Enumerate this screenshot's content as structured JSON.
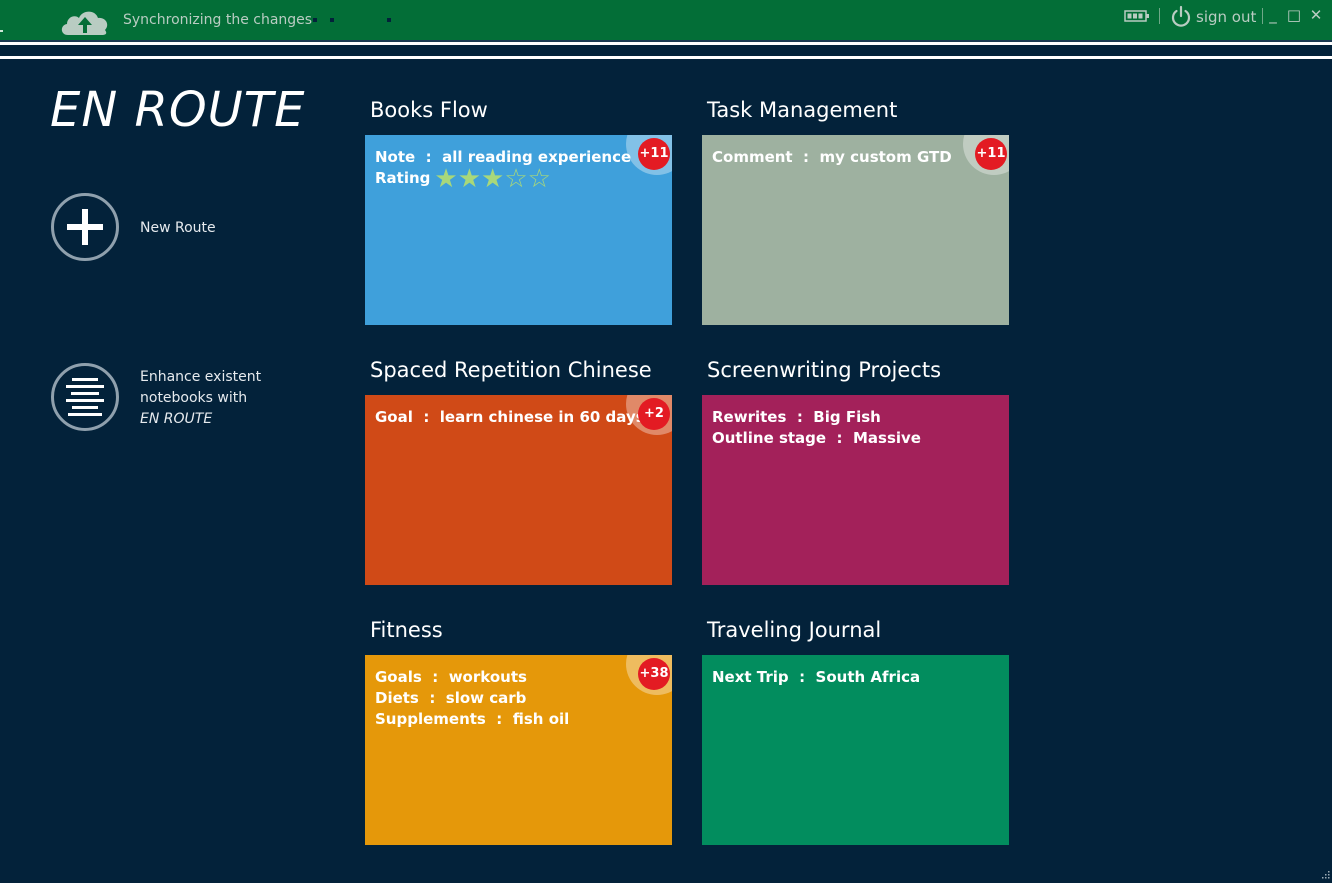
{
  "titlebar": {
    "sync_text": "Synchronizing the changes",
    "sign_out": "sign out",
    "minimize_glyph": "_",
    "maximize_glyph": "□",
    "close_glyph": "✕",
    "color": "#036e37"
  },
  "sidebar": {
    "app_title": "EN ROUTE",
    "new_route_label": "New Route",
    "enhance_line1": "Enhance existent",
    "enhance_line2": "notebooks with",
    "enhance_line3": "EN ROUTE"
  },
  "routes": [
    {
      "title": "Books Flow",
      "color": "#3fa0db",
      "badge": "+11",
      "lines": [
        {
          "label": "Note",
          "value": "all reading experience"
        },
        {
          "label": "Rating",
          "value": ""
        }
      ],
      "rating": {
        "filled": 3,
        "total": 5
      }
    },
    {
      "title": "Task Management",
      "color": "#9eb1a0",
      "badge": "+11",
      "lines": [
        {
          "label": "Comment",
          "value": "my custom GTD"
        }
      ]
    },
    {
      "title": "Spaced Repetition Chinese",
      "color": "#d04a17",
      "badge": "+2",
      "lines": [
        {
          "label": "Goal",
          "value": "learn chinese in 60 days"
        }
      ]
    },
    {
      "title": "Screenwriting Projects",
      "color": "#a3215a",
      "badge": "",
      "lines": [
        {
          "label": "Rewrites",
          "value": "Big Fish"
        },
        {
          "label": "Outline stage",
          "value": "Massive"
        }
      ]
    },
    {
      "title": "Fitness",
      "color": "#e5980a",
      "badge": "+38",
      "lines": [
        {
          "label": "Goals",
          "value": "workouts"
        },
        {
          "label": "Diets",
          "value": "slow carb"
        },
        {
          "label": "Supplements",
          "value": "fish oil"
        }
      ]
    },
    {
      "title": "Traveling Journal",
      "color": "#028d5e",
      "badge": "",
      "lines": [
        {
          "label": "Next Trip",
          "value": "South Africa"
        }
      ]
    }
  ],
  "colors": {
    "background": "#03223a",
    "badge": "#e31b23",
    "star": "#a8d87a"
  }
}
